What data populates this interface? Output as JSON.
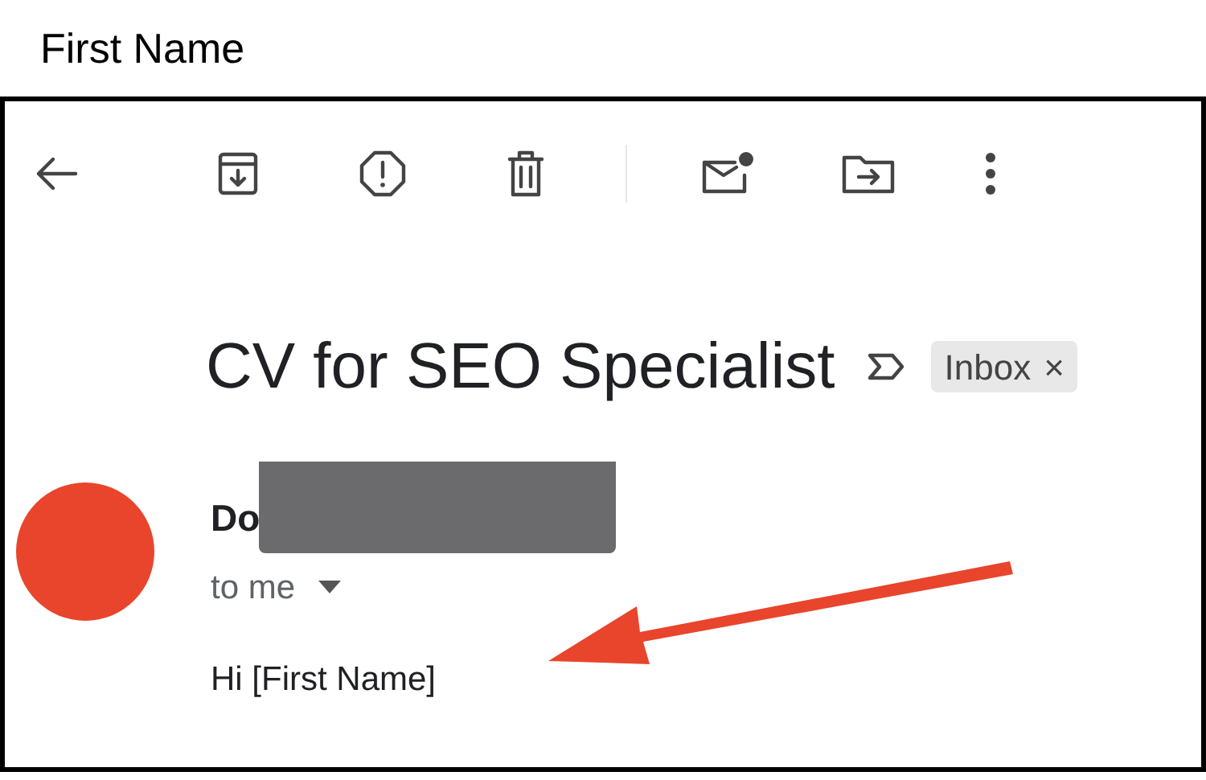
{
  "caption": "First Name",
  "email": {
    "subject": "CV for SEO Specialist",
    "label": "Inbox",
    "label_close": "×",
    "sender": "Do",
    "recipient": "to me",
    "body": "Hi [First Name]"
  }
}
